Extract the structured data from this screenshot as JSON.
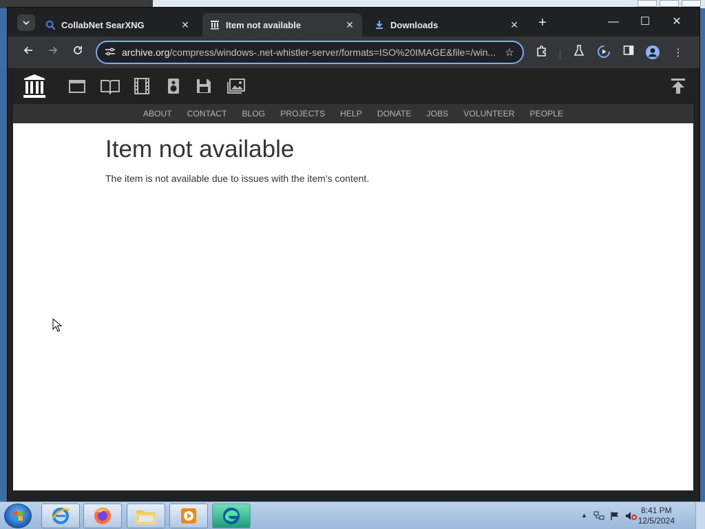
{
  "browser": {
    "tabs": [
      {
        "label": "CollabNet SearXNG",
        "icon": "search-icon",
        "active": false
      },
      {
        "label": "Item not available",
        "icon": "archive-icon",
        "active": true
      },
      {
        "label": "Downloads",
        "icon": "download-icon",
        "active": false
      }
    ],
    "url_host": "archive.org",
    "url_path": "/compress/windows-.net-whistler-server/formats=ISO%20IMAGE&file=/win...",
    "accent": "#7cacf8"
  },
  "archive": {
    "nav": [
      "ABOUT",
      "CONTACT",
      "BLOG",
      "PROJECTS",
      "HELP",
      "DONATE",
      "JOBS",
      "VOLUNTEER",
      "PEOPLE"
    ],
    "media_icons": [
      "web-icon",
      "texts-icon",
      "video-icon",
      "audio-icon",
      "software-icon",
      "images-icon"
    ]
  },
  "page": {
    "title": "Item not available",
    "message": "The item is not available due to issues with the item's content."
  },
  "taskbar": {
    "time": "8:41 PM",
    "date": "12/5/2024"
  }
}
